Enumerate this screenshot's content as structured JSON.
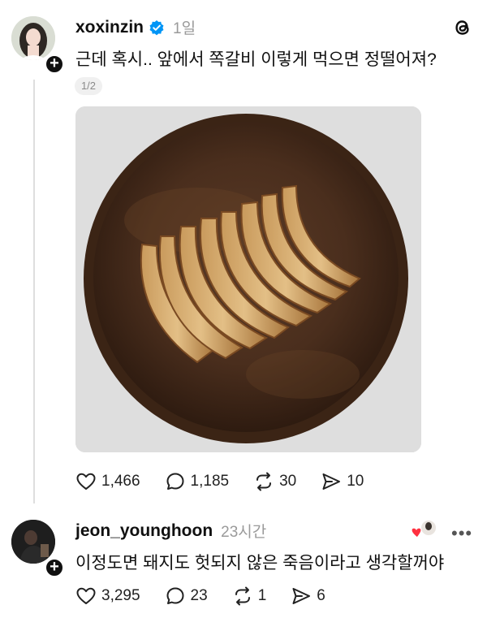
{
  "main_post": {
    "username": "xoxinzin",
    "timestamp": "1일",
    "text": "근데 혹시.. 앞에서 쪽갈비 이렇게 먹으면 정떨어져?",
    "page_indicator": "1/2",
    "stats": {
      "likes": "1,466",
      "comments": "1,185",
      "reposts": "30",
      "shares": "10"
    },
    "icons": {
      "verified": "verified-badge-icon",
      "app": "threads-logo-icon"
    },
    "colors": {
      "verified_blue": "#0095f6",
      "text": "#101010",
      "muted": "#9a9a9a"
    }
  },
  "reply": {
    "username": "jeon_younghoon",
    "timestamp": "23시간",
    "text": "이정도면 돼지도 헛되지 않은 죽음이라고 생각할꺼야",
    "stats": {
      "likes": "3,295",
      "comments": "23",
      "reposts": "1",
      "shares": "6"
    },
    "liked_by_author_color": "#ff3040"
  }
}
